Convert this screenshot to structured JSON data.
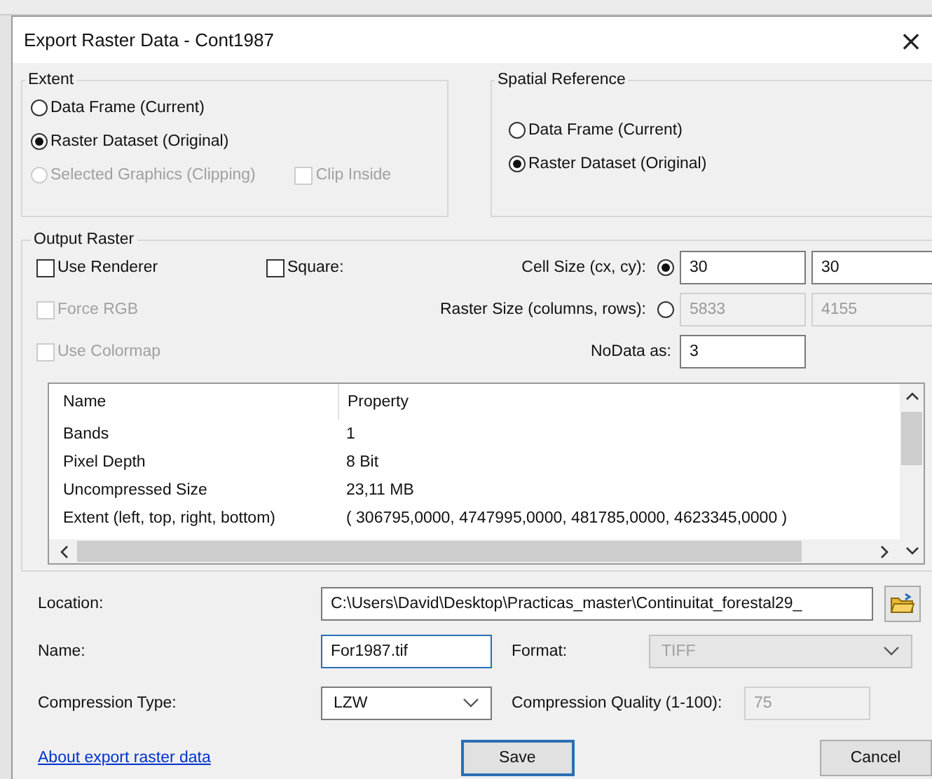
{
  "window": {
    "title": "Export Raster Data - Cont1987",
    "close": "×"
  },
  "extent": {
    "title": "Extent",
    "options": [
      {
        "label": "Data Frame (Current)",
        "selected": false,
        "disabled": false
      },
      {
        "label": "Raster Dataset (Original)",
        "selected": true,
        "disabled": false
      },
      {
        "label": "Selected Graphics (Clipping)",
        "selected": false,
        "disabled": true
      }
    ],
    "clip_inside": {
      "label": "Clip Inside",
      "checked": false,
      "disabled": true
    }
  },
  "spatial_reference": {
    "title": "Spatial Reference",
    "options": [
      {
        "label": "Data Frame (Current)",
        "selected": false,
        "disabled": false
      },
      {
        "label": "Raster Dataset (Original)",
        "selected": true,
        "disabled": false
      }
    ]
  },
  "output_raster": {
    "title": "Output Raster",
    "use_renderer": {
      "label": "Use Renderer",
      "checked": false,
      "disabled": false
    },
    "square": {
      "label": "Square:",
      "checked": false,
      "disabled": false
    },
    "force_rgb": {
      "label": "Force RGB",
      "checked": false,
      "disabled": true
    },
    "use_colormap": {
      "label": "Use Colormap",
      "checked": false,
      "disabled": true
    },
    "cell_size": {
      "label": "Cell Size (cx, cy):",
      "selected": true,
      "values": [
        "30",
        "30"
      ]
    },
    "raster_size": {
      "label": "Raster Size (columns, rows):",
      "selected": false,
      "values": [
        "5833",
        "4155"
      ]
    },
    "nodata": {
      "label": "NoData as:",
      "value": "3"
    },
    "properties": {
      "columns": [
        "Name",
        "Property"
      ],
      "rows": [
        {
          "name": "Bands",
          "property": "1"
        },
        {
          "name": "Pixel Depth",
          "property": "8 Bit"
        },
        {
          "name": "Uncompressed Size",
          "property": "23,11 MB"
        },
        {
          "name": "Extent (left, top, right, bottom)",
          "property": "( 306795,0000, 4747995,0000, 481785,0000, 4623345,0000 )"
        }
      ]
    }
  },
  "location": {
    "label": "Location:",
    "value": "C:\\Users\\David\\Desktop\\Practicas_master\\Continuitat_forestal29_"
  },
  "name": {
    "label": "Name:",
    "value": "For1987.tif"
  },
  "format": {
    "label": "Format:",
    "value": "TIFF"
  },
  "compression_type": {
    "label": "Compression Type:",
    "value": "LZW"
  },
  "compression_quality": {
    "label": "Compression Quality (1-100):",
    "value": "75",
    "disabled": true
  },
  "footer": {
    "link": "About export raster data",
    "buttons": [
      {
        "label": "Save",
        "default": true
      },
      {
        "label": "Cancel",
        "default": false
      }
    ]
  }
}
